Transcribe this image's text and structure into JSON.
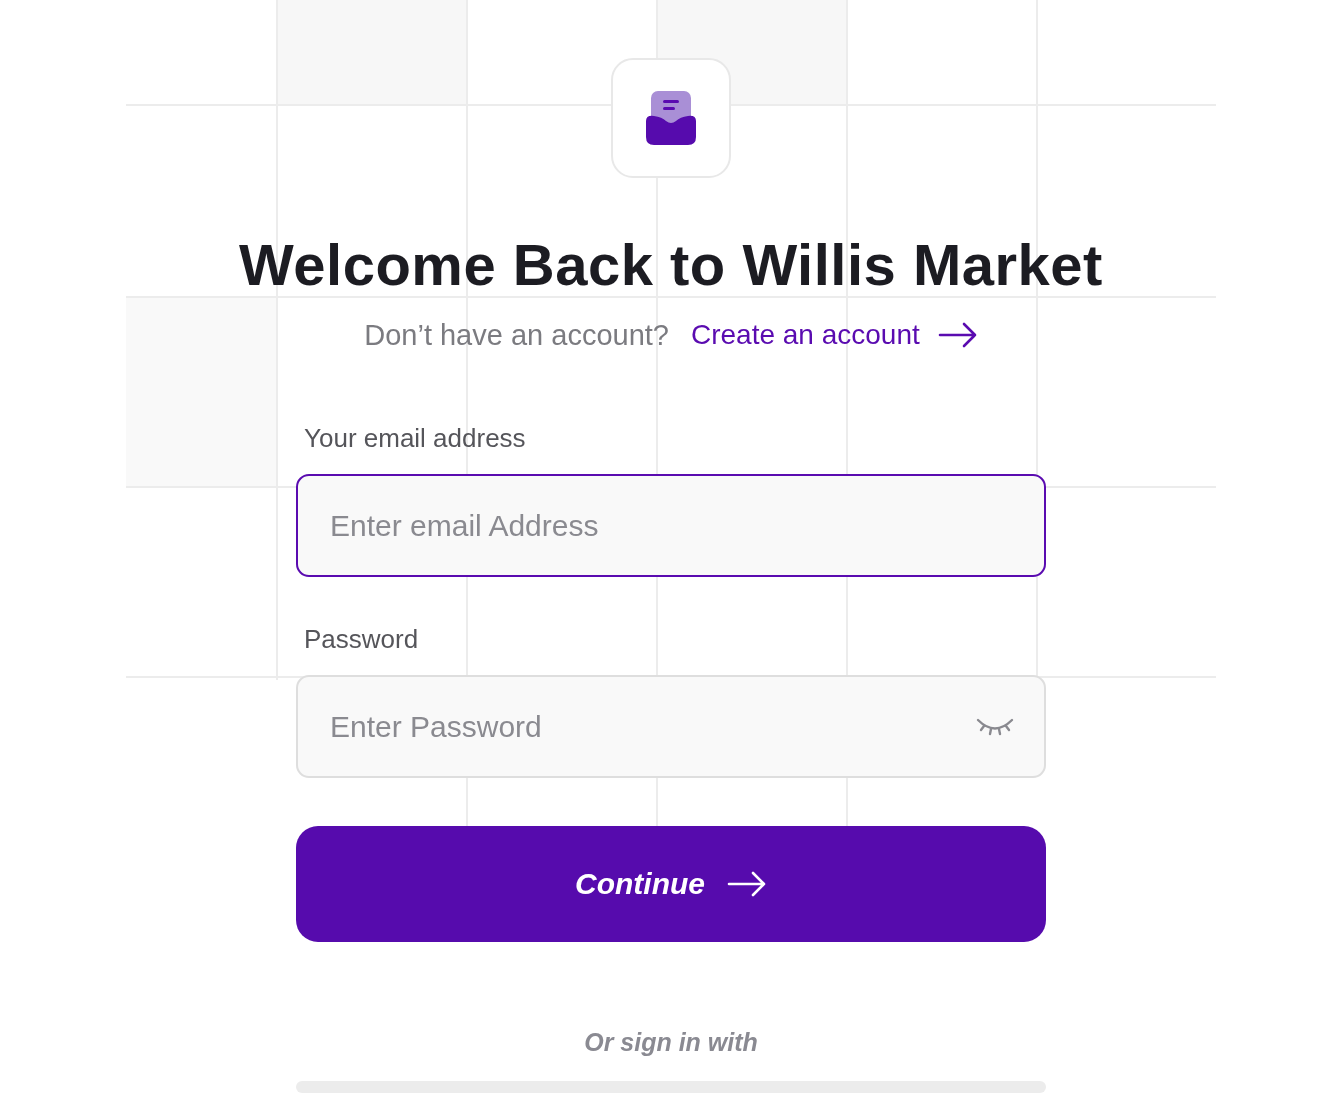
{
  "title": "Welcome Back to Willis Market",
  "signup_prompt": {
    "text": "Don’t have an account?",
    "link": "Create an account"
  },
  "fields": [
    {
      "kind": "email",
      "label": "Your email address",
      "placeholder": "Enter email Address",
      "focused": true
    },
    {
      "kind": "password",
      "label": "Password",
      "placeholder": "Enter Password",
      "focused": false
    }
  ],
  "submit_button": "Continue",
  "divider_text": "Or sign in with"
}
